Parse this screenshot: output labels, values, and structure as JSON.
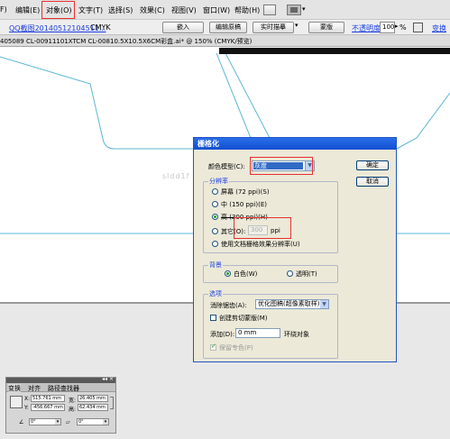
{
  "menubar": {
    "items": [
      "F)",
      "编辑(E)",
      "对象(O)",
      "文字(T)",
      "选择(S)",
      "效果(C)",
      "视图(V)",
      "窗口(W)",
      "帮助(H)"
    ]
  },
  "controlbar": {
    "file_link": "QQ截图20140512104511...",
    "color_mode": "CMYK",
    "embed_button": "嵌入",
    "edit_original_button": "编辑原稿",
    "live_trace_button": "实时描摹",
    "mask_button": "蒙版",
    "opacity_label": "不透明度:",
    "opacity_value": "100",
    "opacity_unit": "%",
    "transform_link": "变换"
  },
  "doctab": {
    "title": "405089 CL-00911101XTCM CL-00810.5X10.5X6CM彩盒.ai* @ 150% (CMYK/预览)"
  },
  "watermark": "sldd1f",
  "dialog": {
    "title": "栅格化",
    "color_model_label": "颜色模型(C):",
    "color_model_value": "灰度",
    "ok_button": "确定",
    "cancel_button": "取消",
    "resolution_group": "分辨率",
    "res_options": [
      "屏幕 (72 ppi)(S)",
      "中 (150 ppi)(E)",
      "高 (300 ppi)(H)",
      "其它(O):",
      "使用文档栅格效果分辨率(U)"
    ],
    "other_value": "300",
    "other_unit": "ppi",
    "background_group": "背景",
    "bg_white": "白色(W)",
    "bg_transparent": "透明(T)",
    "options_group": "选项",
    "antialias_label": "消除锯齿(A):",
    "antialias_value": "优化图稿(超像素取样)",
    "clip_mask_label": "创建剪切蒙版(M)",
    "add_label": "添加(D):",
    "add_value": "0 mm",
    "add_suffix": "环绕对象",
    "preserve_spot_label": "保留专色(P)"
  },
  "transform_panel": {
    "tabs": [
      "变换",
      "对齐",
      "路径查找器"
    ],
    "x_label": "X:",
    "x_value": "515.761 mm",
    "y_label": "Y:",
    "y_value": "-456.667 mm",
    "w_label": "宽:",
    "w_value": "26.405 mm",
    "h_label": "高:",
    "h_value": "62.434 mm",
    "rotate_value": "0°",
    "shear_value": "0°"
  },
  "colors": {
    "artwork_line": "#5bb7d4",
    "highlight_red": "#e83030",
    "link_blue": "#1a3ee0",
    "title_blue": "#0f4fd0"
  }
}
